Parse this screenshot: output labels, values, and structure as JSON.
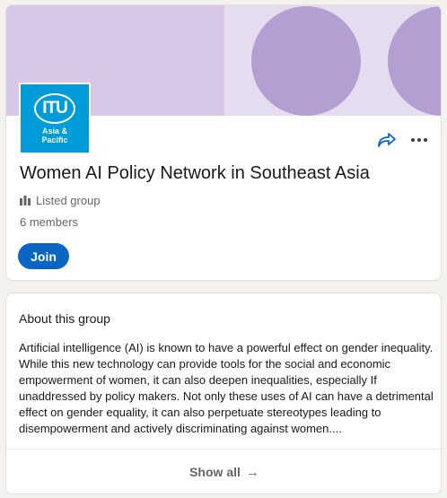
{
  "group": {
    "logo": {
      "mark": "ITU",
      "subtitle_line1": "Asia &",
      "subtitle_line2": "Pacific"
    },
    "name": "Women AI Policy Network in Southeast Asia",
    "visibility": "Listed group",
    "members": "6 members",
    "join_label": "Join",
    "icons": {
      "share": "share-arrow-icon",
      "more": "more-dots-icon",
      "visibility": "group-people-icon"
    },
    "colors": {
      "banner_bg": "#e6dcf0",
      "banner_left": "#d8c8e8",
      "banner_circle": "#b59fd2",
      "logo_bg": "#009cd9",
      "accent": "#0a66c2"
    }
  },
  "about": {
    "heading": "About this group",
    "description": "Artificial intelligence (AI) is known to have a powerful effect on gender inequality. While this new technology can provide tools for the social and economic empowerment of women, it can also deepen inequalities, especially If unaddressed by policy makers. Not only these uses of AI can have a detrimental effect on gender equality, it can also perpetuate stereotypes leading to disempowerment and actively discriminating against women....",
    "show_all_label": "Show all",
    "show_all_icon": "arrow-right-icon"
  }
}
